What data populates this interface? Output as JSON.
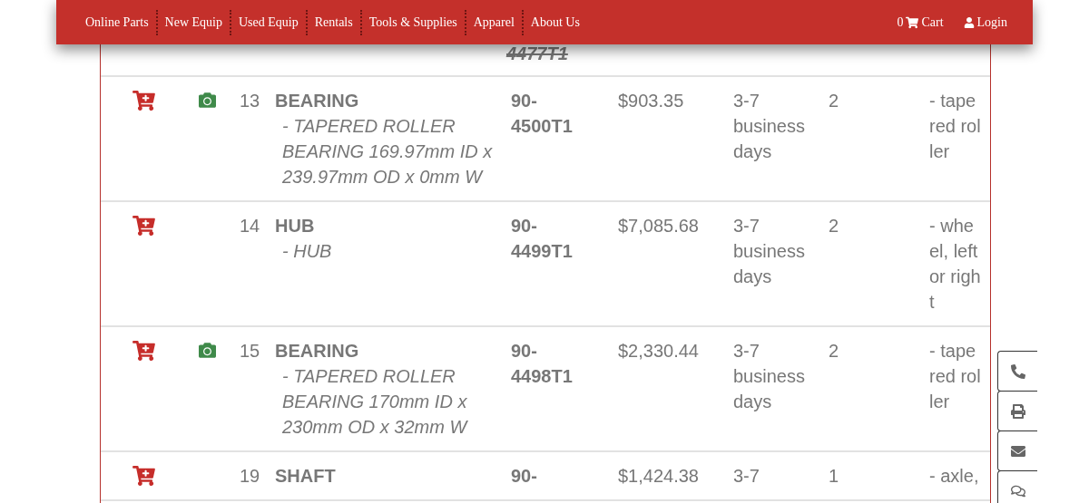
{
  "nav": {
    "links": [
      {
        "label": "Online Parts"
      },
      {
        "label": "New Equip"
      },
      {
        "label": "Used Equip"
      },
      {
        "label": "Rentals"
      },
      {
        "label": "Tools & Supplies"
      },
      {
        "label": "Apparel"
      },
      {
        "label": "About Us"
      }
    ],
    "cart_count": "0",
    "cart_label": "Cart",
    "login_label": "Login"
  },
  "previous_row": {
    "part_tail": "4477T1",
    "struck": true
  },
  "rows": [
    {
      "number": "13",
      "name": "BEARING",
      "description": "- TAPERED ROLLER BEARING 169.97mm ID x 239.97mm OD x 0mm W",
      "has_photo": true,
      "part": "90-4500T1",
      "price": "$903.35",
      "delivery": "3-7 business days",
      "qty": "2",
      "note": "- tapered roller"
    },
    {
      "number": "14",
      "name": "HUB",
      "description": "- HUB",
      "has_photo": false,
      "part": "90-4499T1",
      "price": "$7,085.68",
      "delivery": "3-7 business days",
      "qty": "2",
      "note": "- wheel, left or right"
    },
    {
      "number": "15",
      "name": "BEARING",
      "description": "- TAPERED ROLLER BEARING 170mm ID x 230mm OD x 32mm W",
      "has_photo": true,
      "part": "90-4498T1",
      "price": "$2,330.44",
      "delivery": "3-7 business days",
      "qty": "2",
      "note": "- tapered roller"
    },
    {
      "number": "19",
      "name": "SHAFT",
      "description": "",
      "has_photo": false,
      "part": "90-",
      "price": "$1,424.38",
      "delivery": "3-7",
      "qty": "1",
      "note": "- axle,"
    }
  ],
  "side_buttons": [
    {
      "kind": "phone"
    },
    {
      "kind": "print"
    },
    {
      "kind": "email"
    },
    {
      "kind": "chat"
    }
  ]
}
